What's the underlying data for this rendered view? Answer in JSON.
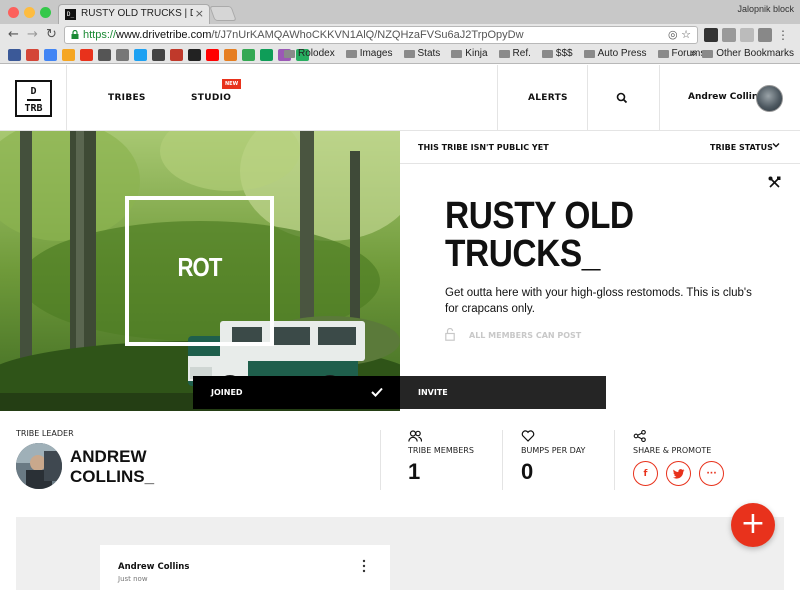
{
  "browser": {
    "tab_title": "RUSTY OLD TRUCKS | DRIVE",
    "favicon_text": "D_",
    "profile_label": "Jalopnik block",
    "url_scheme": "https://",
    "url_domain": "www.drivetribe.com",
    "url_path": "/t/J7nUrKAMQAWhoCKKVN1AlQ/NZQHzaFVSu6aJ2TrpOpyDw",
    "bookmarks": [
      "Rolodex",
      "Images",
      "Stats",
      "Kinja",
      "Ref.",
      "$$$",
      "Auto Press",
      "Forums"
    ],
    "more_bookmarks": "»",
    "other_bookmarks": "Other Bookmarks"
  },
  "header": {
    "logo_line1": "D",
    "logo_line2": "TRB",
    "nav_tribes": "TRIBES",
    "nav_studio": "STUDIO",
    "new_badge": "NEW",
    "nav_alerts": "ALERTS",
    "user_name": "Andrew Collins"
  },
  "hero": {
    "image_label": "ROT",
    "privacy_notice": "THIS TRIBE ISN'T PUBLIC YET",
    "tribe_status": "TRIBE STATUS",
    "title_line1": "RUSTY OLD",
    "title_line2": "TRUCKS_",
    "description": "Get outta here with your high-gloss restomods. This is club's for crapcans only.",
    "posting_rule": "ALL MEMBERS CAN POST",
    "joined_label": "JOINED",
    "invite_label": "INVITE"
  },
  "stats": {
    "leader_label": "TRIBE LEADER",
    "leader_first": "ANDREW",
    "leader_last": "COLLINS_",
    "members_label": "TRIBE MEMBERS",
    "members_value": "1",
    "bumps_label": "BUMPS PER DAY",
    "bumps_value": "0",
    "share_label": "SHARE & PROMOTE",
    "share_facebook": "f",
    "share_more": "···"
  },
  "feed": {
    "post_author": "Andrew Collins",
    "post_time": "Just now"
  },
  "fab_label": "+",
  "colors": {
    "accent": "#e8321c",
    "black": "#000000",
    "invite_bg": "#252525",
    "feed_bg": "#efefef"
  }
}
